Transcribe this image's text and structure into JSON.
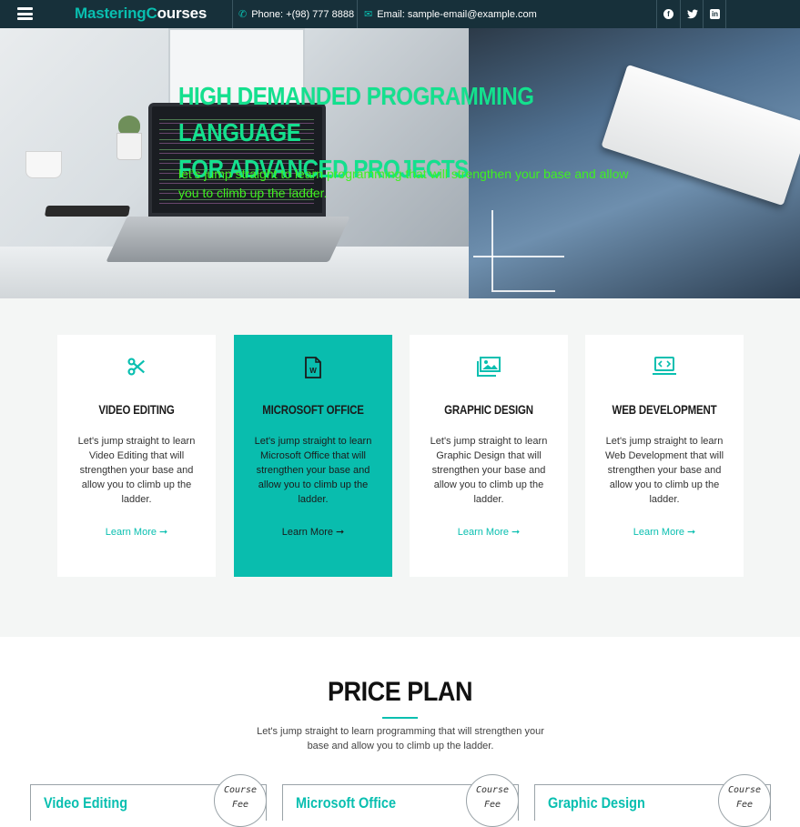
{
  "topbar": {
    "brand_part1": "Mastering",
    "brand_part2": "C",
    "brand_part3": "ourses",
    "phone_label": "Phone: +(98) 777 8888",
    "email_label": "Email: sample-email@example.com",
    "social_icons": [
      "facebook-icon",
      "twitter-icon",
      "linkedin-icon"
    ]
  },
  "hero": {
    "title_line1": "HIGH DEMANDED PROGRAMMING LANGUAGE",
    "title_line2": "FOR ADVANCED PROJECTS",
    "subtitle": "let's jump straight to learn programming that will strengthen your base and allow you to climb up the ladder."
  },
  "services": [
    {
      "icon": "scissors-icon",
      "title": "VIDEO EDITING",
      "text": "Let's jump straight to learn Video Editing that will strengthen your base and allow you to climb up the ladder.",
      "link": "Learn More"
    },
    {
      "icon": "word-file-icon",
      "title": "MICROSOFT OFFICE",
      "text": "Let's jump straight to learn Microsoft Office that will strengthen your base and allow you to climb up the ladder.",
      "link": "Learn More"
    },
    {
      "icon": "images-icon",
      "title": "GRAPHIC DESIGN",
      "text": "Let's jump straight to learn Graphic Design that will strengthen your base and allow you to climb up the ladder.",
      "link": "Learn More"
    },
    {
      "icon": "laptop-code-icon",
      "title": "WEB DEVELOPMENT",
      "text": "Let's jump straight to learn Web Development that will strengthen your base and allow you to climb up the ladder.",
      "link": "Learn More"
    }
  ],
  "price": {
    "title": "PRICE PLAN",
    "subtitle": "Let's jump straight to learn programming that will strengthen your base and allow you to climb up the ladder.",
    "plans": [
      {
        "name": "Video Editing",
        "fee_line1": "Course",
        "fee_line2": "Fee"
      },
      {
        "name": "Microsoft Office",
        "fee_line1": "Course",
        "fee_line2": "Fee"
      },
      {
        "name": "Graphic Design",
        "fee_line1": "Course",
        "fee_line2": "Fee"
      }
    ]
  },
  "colors": {
    "accent": "#09bfb0",
    "topbar": "#17303a",
    "hero_title": "#14e08e",
    "hero_sub": "#3ff21f"
  }
}
